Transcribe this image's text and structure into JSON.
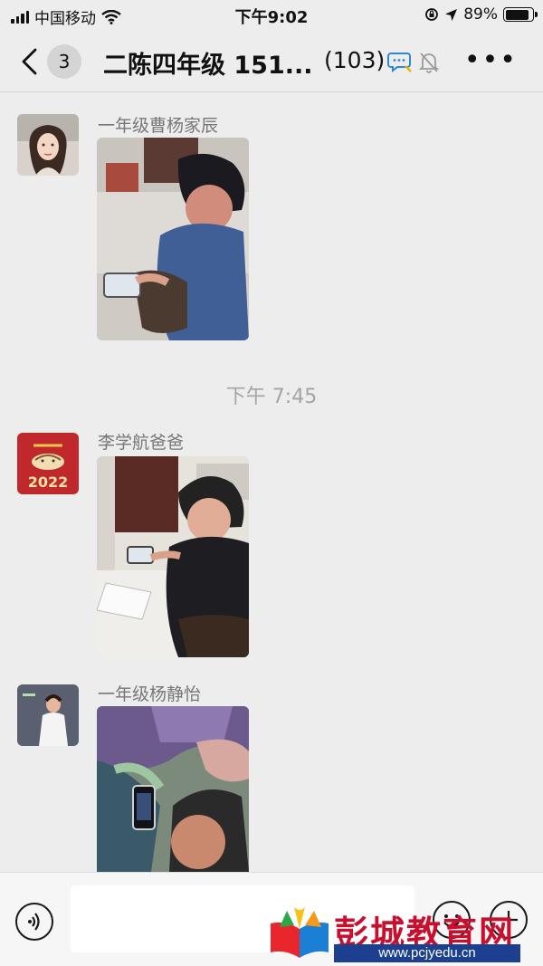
{
  "status_bar": {
    "carrier": "中国移动",
    "time": "下午9:02",
    "battery": "89%",
    "battery_level": 0.89
  },
  "nav": {
    "unread_count": "3",
    "title": "二陈四年级 151...",
    "member_count": "(103)"
  },
  "messages": [
    {
      "sender": "一年级曹杨家辰",
      "type": "image"
    },
    {
      "sender": "李学航爸爸",
      "type": "image",
      "avatar_text": "2022"
    },
    {
      "sender": "一年级杨静怡",
      "type": "image"
    }
  ],
  "timestamp": "下午 7:45",
  "watermark": {
    "brand": "彭城教育网",
    "url": "www.pcjyedu.cn"
  },
  "colors": {
    "background": "#ededed",
    "brand_red": "#c8102e",
    "brand_blue": "#1c3f8f",
    "chat_bubble_icon": "#2b88d8"
  }
}
